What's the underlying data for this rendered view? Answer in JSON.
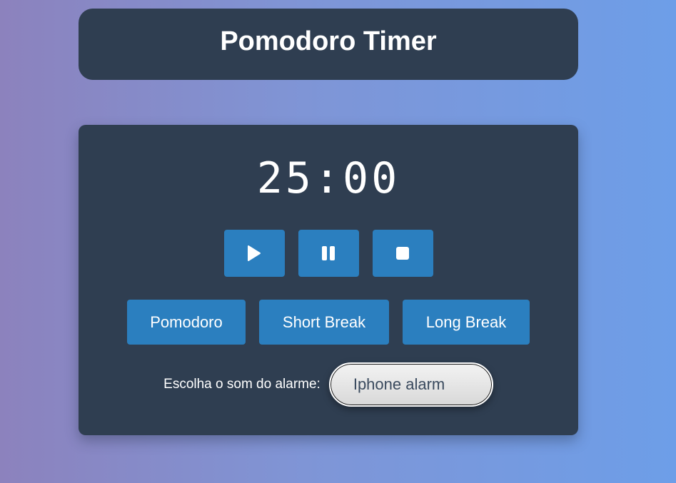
{
  "header": {
    "title": "Pomodoro Timer"
  },
  "timer": {
    "display": "25:00"
  },
  "controls": {
    "play_icon": "play-icon",
    "pause_icon": "pause-icon",
    "stop_icon": "stop-icon"
  },
  "modes": [
    {
      "label": "Pomodoro"
    },
    {
      "label": "Short Break"
    },
    {
      "label": "Long Break"
    }
  ],
  "alarm": {
    "label": "Escolha o som do alarme:",
    "selected": "Iphone alarm"
  },
  "colors": {
    "card": "#2f3e51",
    "button": "#2b7fbf",
    "text": "#ffffff"
  }
}
